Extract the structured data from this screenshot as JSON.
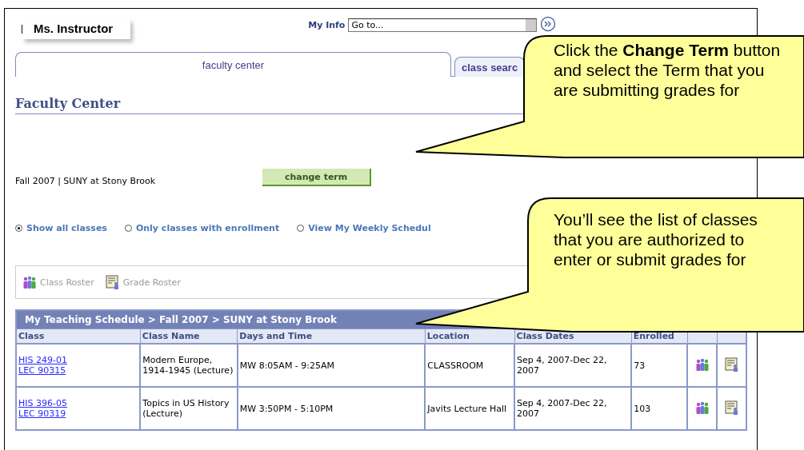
{
  "header": {
    "user_name": "Ms. Instructor",
    "my_info_label": "My Info",
    "goto_value": "Go to..."
  },
  "tabs": [
    {
      "label": "faculty center",
      "selected": true
    },
    {
      "label": "class searc",
      "selected": false
    }
  ],
  "page_title": "Faculty Center",
  "term": "Fall 2007 | SUNY at Stony Brook",
  "change_term_button": "change term",
  "view_options": [
    {
      "label": "Show all classes",
      "selected": true
    },
    {
      "label": "Only classes with enrollment",
      "selected": false
    },
    {
      "label": "View My Weekly Schedul",
      "selected": false
    }
  ],
  "roster_actions": [
    {
      "label": "Class Roster",
      "kind": "people"
    },
    {
      "label": "Grade Roster",
      "kind": "grades"
    }
  ],
  "schedule": {
    "caption": "My Teaching Schedule > Fall 2007 > SUNY at Stony Brook",
    "columns": [
      "Class",
      "Class Name",
      "Days and Time",
      "Location",
      "Class Dates",
      "Enrolled"
    ],
    "rows": [
      {
        "class_links": [
          "HIS 249-01",
          "LEC 90315"
        ],
        "class_name": "Modern Europe, 1914-1945 (Lecture)",
        "days_time": "MW 8:05AM - 9:25AM",
        "location": "CLASSROOM",
        "dates": "Sep 4, 2007-Dec 22, 2007",
        "enrolled": "73"
      },
      {
        "class_links": [
          "HIS 396-05",
          "LEC 90319"
        ],
        "class_name": "Topics in US History (Lecture)",
        "days_time": "MW 3:50PM - 5:10PM",
        "location": "Javits Lecture Hall",
        "dates": "Sep 4, 2007-Dec 22, 2007",
        "enrolled": "103"
      }
    ]
  },
  "callouts": [
    "Click the **Change Term** button and select the Term that you are submitting grades for",
    "You’ll see the list of classes that you are authorized to enter or submit grades for"
  ]
}
